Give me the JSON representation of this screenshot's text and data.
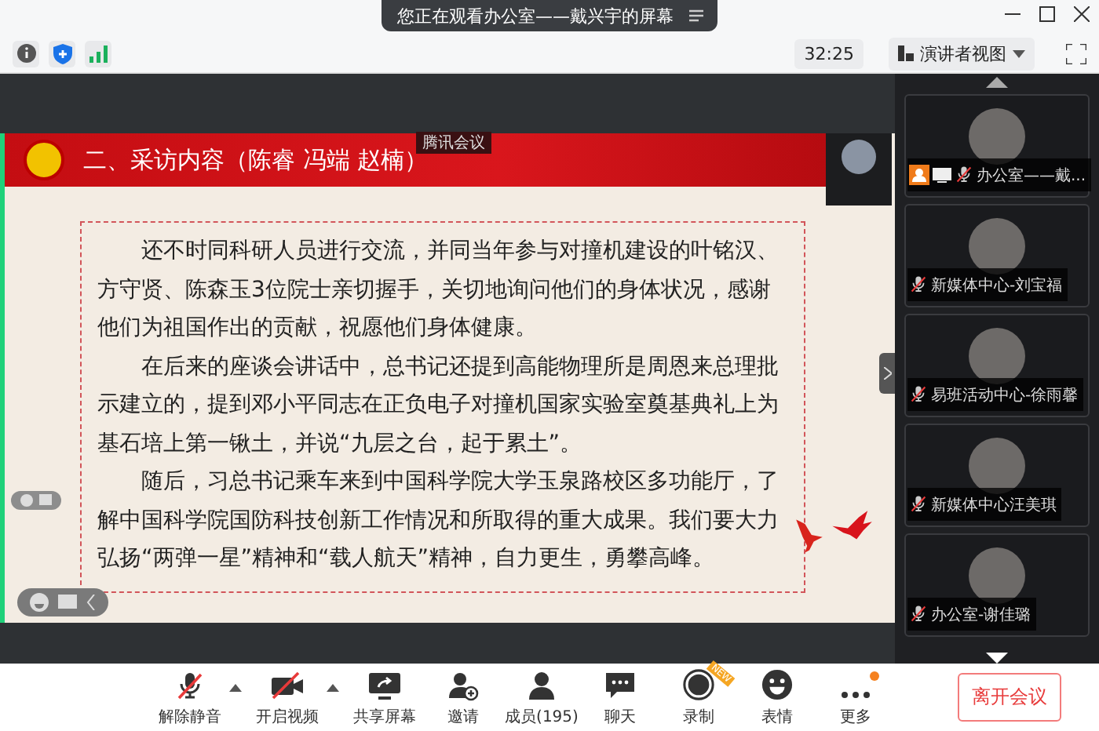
{
  "window": {
    "title": "您正在观看办公室——戴兴宇的屏幕"
  },
  "toolbar": {
    "timer": "32:25",
    "view_button": "演讲者视图"
  },
  "slide": {
    "badge": "腾讯会议",
    "title": "二、采访内容（陈睿 冯端 赵楠）",
    "paragraphs": [
      "还不时同科研人员进行交流，并同当年参与对撞机建设的叶铭汉、方守贤、陈森玉3位院士亲切握手，关切地询问他们的身体状况，感谢他们为祖国作出的贡献，祝愿他们身体健康。",
      "在后来的座谈会讲话中，总书记还提到高能物理所是周恩来总理批示建立的，提到邓小平同志在正负电子对撞机国家实验室奠基典礼上为基石培上第一锹土，并说“九层之台，起于累土”。",
      "随后，习总书记乘车来到中国科学院大学玉泉路校区多功能厅，了解中国科学院国防科技创新工作情况和所取得的重大成果。我们要大力弘扬“两弹一星”精神和“载人航天”精神，自力更生，勇攀高峰。"
    ]
  },
  "participants": [
    {
      "name": "办公室——戴...",
      "muted": true,
      "host": true,
      "sharing": true
    },
    {
      "name": "新媒体中心-刘宝福",
      "muted": true,
      "host": false,
      "sharing": false
    },
    {
      "name": "易班活动中心-徐雨馨",
      "muted": true,
      "host": false,
      "sharing": false
    },
    {
      "name": "新媒体中心汪美琪",
      "muted": true,
      "host": false,
      "sharing": false
    },
    {
      "name": "办公室-谢佳璐",
      "muted": true,
      "host": false,
      "sharing": false
    }
  ],
  "controls": [
    {
      "kind": "mic",
      "label": "解除静音",
      "caret": true
    },
    {
      "kind": "video",
      "label": "开启视频",
      "caret": true
    },
    {
      "kind": "share",
      "label": "共享屏幕",
      "caret": false
    },
    {
      "kind": "invite",
      "label": "邀请",
      "caret": false
    },
    {
      "kind": "members",
      "label": "成员(195)",
      "caret": false
    },
    {
      "kind": "chat",
      "label": "聊天",
      "caret": false
    },
    {
      "kind": "record",
      "label": "录制",
      "caret": false,
      "badge": "NEW"
    },
    {
      "kind": "emoji",
      "label": "表情",
      "caret": false
    },
    {
      "kind": "more",
      "label": "更多",
      "caret": false,
      "notify": true
    }
  ],
  "leave_button": "离开会议"
}
